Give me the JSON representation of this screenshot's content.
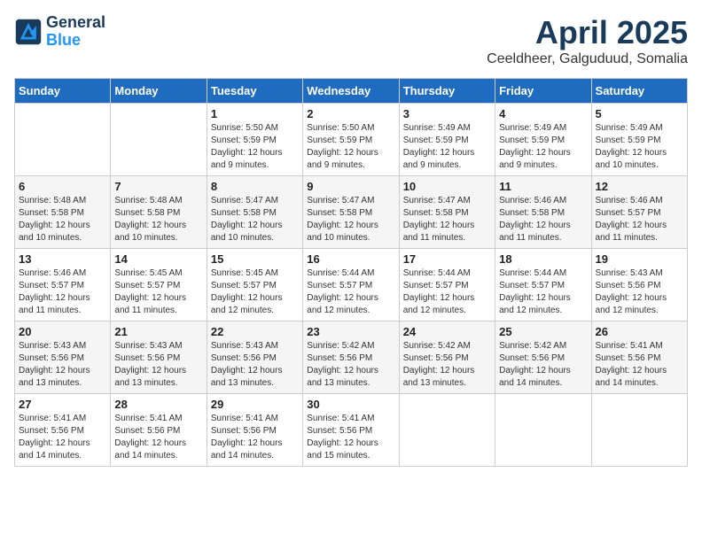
{
  "header": {
    "logo_line1": "General",
    "logo_line2": "Blue",
    "month": "April 2025",
    "location": "Ceeldheer, Galguduud, Somalia"
  },
  "weekdays": [
    "Sunday",
    "Monday",
    "Tuesday",
    "Wednesday",
    "Thursday",
    "Friday",
    "Saturday"
  ],
  "weeks": [
    [
      {
        "day": "",
        "sunrise": "",
        "sunset": "",
        "daylight": ""
      },
      {
        "day": "",
        "sunrise": "",
        "sunset": "",
        "daylight": ""
      },
      {
        "day": "1",
        "sunrise": "Sunrise: 5:50 AM",
        "sunset": "Sunset: 5:59 PM",
        "daylight": "Daylight: 12 hours and 9 minutes."
      },
      {
        "day": "2",
        "sunrise": "Sunrise: 5:50 AM",
        "sunset": "Sunset: 5:59 PM",
        "daylight": "Daylight: 12 hours and 9 minutes."
      },
      {
        "day": "3",
        "sunrise": "Sunrise: 5:49 AM",
        "sunset": "Sunset: 5:59 PM",
        "daylight": "Daylight: 12 hours and 9 minutes."
      },
      {
        "day": "4",
        "sunrise": "Sunrise: 5:49 AM",
        "sunset": "Sunset: 5:59 PM",
        "daylight": "Daylight: 12 hours and 9 minutes."
      },
      {
        "day": "5",
        "sunrise": "Sunrise: 5:49 AM",
        "sunset": "Sunset: 5:59 PM",
        "daylight": "Daylight: 12 hours and 10 minutes."
      }
    ],
    [
      {
        "day": "6",
        "sunrise": "Sunrise: 5:48 AM",
        "sunset": "Sunset: 5:58 PM",
        "daylight": "Daylight: 12 hours and 10 minutes."
      },
      {
        "day": "7",
        "sunrise": "Sunrise: 5:48 AM",
        "sunset": "Sunset: 5:58 PM",
        "daylight": "Daylight: 12 hours and 10 minutes."
      },
      {
        "day": "8",
        "sunrise": "Sunrise: 5:47 AM",
        "sunset": "Sunset: 5:58 PM",
        "daylight": "Daylight: 12 hours and 10 minutes."
      },
      {
        "day": "9",
        "sunrise": "Sunrise: 5:47 AM",
        "sunset": "Sunset: 5:58 PM",
        "daylight": "Daylight: 12 hours and 10 minutes."
      },
      {
        "day": "10",
        "sunrise": "Sunrise: 5:47 AM",
        "sunset": "Sunset: 5:58 PM",
        "daylight": "Daylight: 12 hours and 11 minutes."
      },
      {
        "day": "11",
        "sunrise": "Sunrise: 5:46 AM",
        "sunset": "Sunset: 5:58 PM",
        "daylight": "Daylight: 12 hours and 11 minutes."
      },
      {
        "day": "12",
        "sunrise": "Sunrise: 5:46 AM",
        "sunset": "Sunset: 5:57 PM",
        "daylight": "Daylight: 12 hours and 11 minutes."
      }
    ],
    [
      {
        "day": "13",
        "sunrise": "Sunrise: 5:46 AM",
        "sunset": "Sunset: 5:57 PM",
        "daylight": "Daylight: 12 hours and 11 minutes."
      },
      {
        "day": "14",
        "sunrise": "Sunrise: 5:45 AM",
        "sunset": "Sunset: 5:57 PM",
        "daylight": "Daylight: 12 hours and 11 minutes."
      },
      {
        "day": "15",
        "sunrise": "Sunrise: 5:45 AM",
        "sunset": "Sunset: 5:57 PM",
        "daylight": "Daylight: 12 hours and 12 minutes."
      },
      {
        "day": "16",
        "sunrise": "Sunrise: 5:44 AM",
        "sunset": "Sunset: 5:57 PM",
        "daylight": "Daylight: 12 hours and 12 minutes."
      },
      {
        "day": "17",
        "sunrise": "Sunrise: 5:44 AM",
        "sunset": "Sunset: 5:57 PM",
        "daylight": "Daylight: 12 hours and 12 minutes."
      },
      {
        "day": "18",
        "sunrise": "Sunrise: 5:44 AM",
        "sunset": "Sunset: 5:57 PM",
        "daylight": "Daylight: 12 hours and 12 minutes."
      },
      {
        "day": "19",
        "sunrise": "Sunrise: 5:43 AM",
        "sunset": "Sunset: 5:56 PM",
        "daylight": "Daylight: 12 hours and 12 minutes."
      }
    ],
    [
      {
        "day": "20",
        "sunrise": "Sunrise: 5:43 AM",
        "sunset": "Sunset: 5:56 PM",
        "daylight": "Daylight: 12 hours and 13 minutes."
      },
      {
        "day": "21",
        "sunrise": "Sunrise: 5:43 AM",
        "sunset": "Sunset: 5:56 PM",
        "daylight": "Daylight: 12 hours and 13 minutes."
      },
      {
        "day": "22",
        "sunrise": "Sunrise: 5:43 AM",
        "sunset": "Sunset: 5:56 PM",
        "daylight": "Daylight: 12 hours and 13 minutes."
      },
      {
        "day": "23",
        "sunrise": "Sunrise: 5:42 AM",
        "sunset": "Sunset: 5:56 PM",
        "daylight": "Daylight: 12 hours and 13 minutes."
      },
      {
        "day": "24",
        "sunrise": "Sunrise: 5:42 AM",
        "sunset": "Sunset: 5:56 PM",
        "daylight": "Daylight: 12 hours and 13 minutes."
      },
      {
        "day": "25",
        "sunrise": "Sunrise: 5:42 AM",
        "sunset": "Sunset: 5:56 PM",
        "daylight": "Daylight: 12 hours and 14 minutes."
      },
      {
        "day": "26",
        "sunrise": "Sunrise: 5:41 AM",
        "sunset": "Sunset: 5:56 PM",
        "daylight": "Daylight: 12 hours and 14 minutes."
      }
    ],
    [
      {
        "day": "27",
        "sunrise": "Sunrise: 5:41 AM",
        "sunset": "Sunset: 5:56 PM",
        "daylight": "Daylight: 12 hours and 14 minutes."
      },
      {
        "day": "28",
        "sunrise": "Sunrise: 5:41 AM",
        "sunset": "Sunset: 5:56 PM",
        "daylight": "Daylight: 12 hours and 14 minutes."
      },
      {
        "day": "29",
        "sunrise": "Sunrise: 5:41 AM",
        "sunset": "Sunset: 5:56 PM",
        "daylight": "Daylight: 12 hours and 14 minutes."
      },
      {
        "day": "30",
        "sunrise": "Sunrise: 5:41 AM",
        "sunset": "Sunset: 5:56 PM",
        "daylight": "Daylight: 12 hours and 15 minutes."
      },
      {
        "day": "",
        "sunrise": "",
        "sunset": "",
        "daylight": ""
      },
      {
        "day": "",
        "sunrise": "",
        "sunset": "",
        "daylight": ""
      },
      {
        "day": "",
        "sunrise": "",
        "sunset": "",
        "daylight": ""
      }
    ]
  ]
}
